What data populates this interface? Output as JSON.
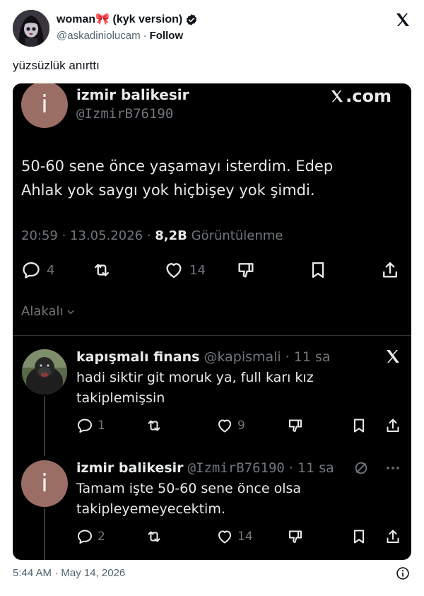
{
  "outer": {
    "author_name": "woman🎀 (kyk version)",
    "handle": "@askadiniolucam",
    "separator": "·",
    "follow_label": "Follow",
    "text": "yüzsüzlük anırttı",
    "timestamp": "5:44 AM · May 14, 2026"
  },
  "screenshot": {
    "brand": ".com",
    "main_tweet": {
      "avatar_letter": "i",
      "name": "izmir balikesir",
      "handle": "@IzmirB76190",
      "text_line1": "50-60 sene önce yaşamayı isterdim. Edep",
      "text_line2": "Ahlak yok saygı yok hiçbişey yok şimdi.",
      "time": "20:59 · 13.05.2026 ·",
      "views_count": "8,2B",
      "views_label": "Görüntülenme",
      "replies": "4",
      "likes": "14"
    },
    "related_label": "Alakalı",
    "reply1": {
      "name": "kapışmalı finans",
      "handle": "@kapismali",
      "time": "· 11 sa",
      "text_line1": "hadi siktir git moruk ya, full karı kız",
      "text_line2": "takiplemişsin",
      "replies": "1",
      "likes": "9"
    },
    "reply2": {
      "avatar_letter": "i",
      "name": "izmir balikesir",
      "handle": "@IzmirB76190",
      "time": "· 11 sa",
      "text_line1": "Tamam işte 50-60 sene önce olsa",
      "text_line2": "takipleyemeyecektim.",
      "replies": "2",
      "likes": "14"
    }
  },
  "icons": {
    "outer_x": "x-logo-icon",
    "verified": "verified-badge-icon",
    "reply": "reply-bubble-icon",
    "retweet": "retweet-icon",
    "like": "heart-icon",
    "dislike": "dislike-icon",
    "bookmark": "bookmark-icon",
    "share": "share-icon",
    "info": "info-icon"
  },
  "colors": {
    "verified": "#0f1419",
    "screenshot_bg": "#000000",
    "muted": "#71767b",
    "avatar_i": "#9a6e64"
  }
}
